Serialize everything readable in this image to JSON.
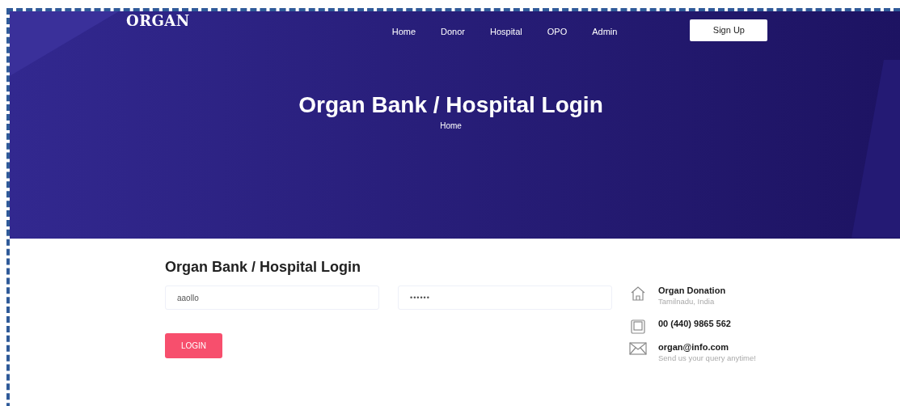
{
  "header": {
    "logo": "ORGAN",
    "nav": [
      {
        "label": "Home"
      },
      {
        "label": "Donor"
      },
      {
        "label": "Hospital"
      },
      {
        "label": "OPO"
      },
      {
        "label": "Admin"
      }
    ],
    "signup": "Sign Up"
  },
  "hero": {
    "title": "Organ Bank / Hospital Login",
    "breadcrumb": "Home"
  },
  "form": {
    "title": "Organ Bank / Hospital Login",
    "fields": [
      {
        "kind": "text",
        "value": "aaollo"
      },
      {
        "kind": "password",
        "value": "••••••"
      }
    ],
    "button": "LOGIN"
  },
  "contact": [
    {
      "kind": "home",
      "title": "Organ Donation",
      "subtitle": "Tamilnadu, India"
    },
    {
      "kind": "phone",
      "title": "00 (440) 9865 562"
    },
    {
      "kind": "mail",
      "title": "organ@info.com",
      "subtitle": "Send us your query anytime!"
    }
  ]
}
